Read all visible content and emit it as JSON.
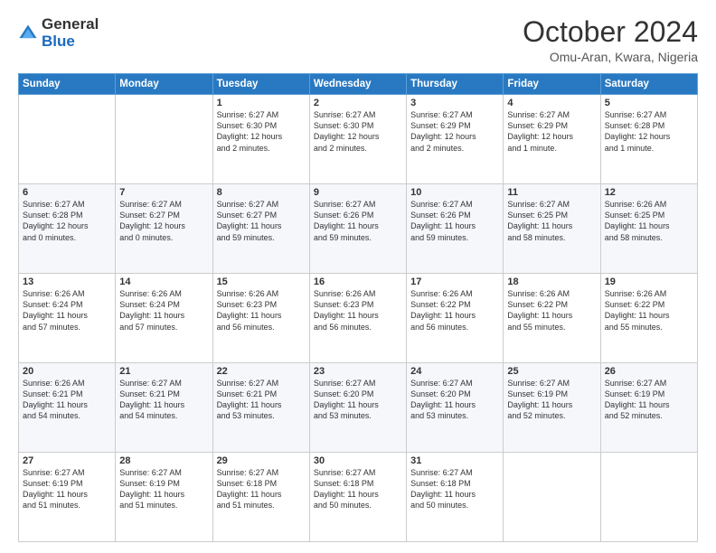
{
  "logo": {
    "general": "General",
    "blue": "Blue"
  },
  "header": {
    "month": "October 2024",
    "location": "Omu-Aran, Kwara, Nigeria"
  },
  "weekdays": [
    "Sunday",
    "Monday",
    "Tuesday",
    "Wednesday",
    "Thursday",
    "Friday",
    "Saturday"
  ],
  "weeks": [
    [
      {
        "day": "",
        "content": ""
      },
      {
        "day": "",
        "content": ""
      },
      {
        "day": "1",
        "content": "Sunrise: 6:27 AM\nSunset: 6:30 PM\nDaylight: 12 hours\nand 2 minutes."
      },
      {
        "day": "2",
        "content": "Sunrise: 6:27 AM\nSunset: 6:30 PM\nDaylight: 12 hours\nand 2 minutes."
      },
      {
        "day": "3",
        "content": "Sunrise: 6:27 AM\nSunset: 6:29 PM\nDaylight: 12 hours\nand 2 minutes."
      },
      {
        "day": "4",
        "content": "Sunrise: 6:27 AM\nSunset: 6:29 PM\nDaylight: 12 hours\nand 1 minute."
      },
      {
        "day": "5",
        "content": "Sunrise: 6:27 AM\nSunset: 6:28 PM\nDaylight: 12 hours\nand 1 minute."
      }
    ],
    [
      {
        "day": "6",
        "content": "Sunrise: 6:27 AM\nSunset: 6:28 PM\nDaylight: 12 hours\nand 0 minutes."
      },
      {
        "day": "7",
        "content": "Sunrise: 6:27 AM\nSunset: 6:27 PM\nDaylight: 12 hours\nand 0 minutes."
      },
      {
        "day": "8",
        "content": "Sunrise: 6:27 AM\nSunset: 6:27 PM\nDaylight: 11 hours\nand 59 minutes."
      },
      {
        "day": "9",
        "content": "Sunrise: 6:27 AM\nSunset: 6:26 PM\nDaylight: 11 hours\nand 59 minutes."
      },
      {
        "day": "10",
        "content": "Sunrise: 6:27 AM\nSunset: 6:26 PM\nDaylight: 11 hours\nand 59 minutes."
      },
      {
        "day": "11",
        "content": "Sunrise: 6:27 AM\nSunset: 6:25 PM\nDaylight: 11 hours\nand 58 minutes."
      },
      {
        "day": "12",
        "content": "Sunrise: 6:26 AM\nSunset: 6:25 PM\nDaylight: 11 hours\nand 58 minutes."
      }
    ],
    [
      {
        "day": "13",
        "content": "Sunrise: 6:26 AM\nSunset: 6:24 PM\nDaylight: 11 hours\nand 57 minutes."
      },
      {
        "day": "14",
        "content": "Sunrise: 6:26 AM\nSunset: 6:24 PM\nDaylight: 11 hours\nand 57 minutes."
      },
      {
        "day": "15",
        "content": "Sunrise: 6:26 AM\nSunset: 6:23 PM\nDaylight: 11 hours\nand 56 minutes."
      },
      {
        "day": "16",
        "content": "Sunrise: 6:26 AM\nSunset: 6:23 PM\nDaylight: 11 hours\nand 56 minutes."
      },
      {
        "day": "17",
        "content": "Sunrise: 6:26 AM\nSunset: 6:22 PM\nDaylight: 11 hours\nand 56 minutes."
      },
      {
        "day": "18",
        "content": "Sunrise: 6:26 AM\nSunset: 6:22 PM\nDaylight: 11 hours\nand 55 minutes."
      },
      {
        "day": "19",
        "content": "Sunrise: 6:26 AM\nSunset: 6:22 PM\nDaylight: 11 hours\nand 55 minutes."
      }
    ],
    [
      {
        "day": "20",
        "content": "Sunrise: 6:26 AM\nSunset: 6:21 PM\nDaylight: 11 hours\nand 54 minutes."
      },
      {
        "day": "21",
        "content": "Sunrise: 6:27 AM\nSunset: 6:21 PM\nDaylight: 11 hours\nand 54 minutes."
      },
      {
        "day": "22",
        "content": "Sunrise: 6:27 AM\nSunset: 6:21 PM\nDaylight: 11 hours\nand 53 minutes."
      },
      {
        "day": "23",
        "content": "Sunrise: 6:27 AM\nSunset: 6:20 PM\nDaylight: 11 hours\nand 53 minutes."
      },
      {
        "day": "24",
        "content": "Sunrise: 6:27 AM\nSunset: 6:20 PM\nDaylight: 11 hours\nand 53 minutes."
      },
      {
        "day": "25",
        "content": "Sunrise: 6:27 AM\nSunset: 6:19 PM\nDaylight: 11 hours\nand 52 minutes."
      },
      {
        "day": "26",
        "content": "Sunrise: 6:27 AM\nSunset: 6:19 PM\nDaylight: 11 hours\nand 52 minutes."
      }
    ],
    [
      {
        "day": "27",
        "content": "Sunrise: 6:27 AM\nSunset: 6:19 PM\nDaylight: 11 hours\nand 51 minutes."
      },
      {
        "day": "28",
        "content": "Sunrise: 6:27 AM\nSunset: 6:19 PM\nDaylight: 11 hours\nand 51 minutes."
      },
      {
        "day": "29",
        "content": "Sunrise: 6:27 AM\nSunset: 6:18 PM\nDaylight: 11 hours\nand 51 minutes."
      },
      {
        "day": "30",
        "content": "Sunrise: 6:27 AM\nSunset: 6:18 PM\nDaylight: 11 hours\nand 50 minutes."
      },
      {
        "day": "31",
        "content": "Sunrise: 6:27 AM\nSunset: 6:18 PM\nDaylight: 11 hours\nand 50 minutes."
      },
      {
        "day": "",
        "content": ""
      },
      {
        "day": "",
        "content": ""
      }
    ]
  ]
}
